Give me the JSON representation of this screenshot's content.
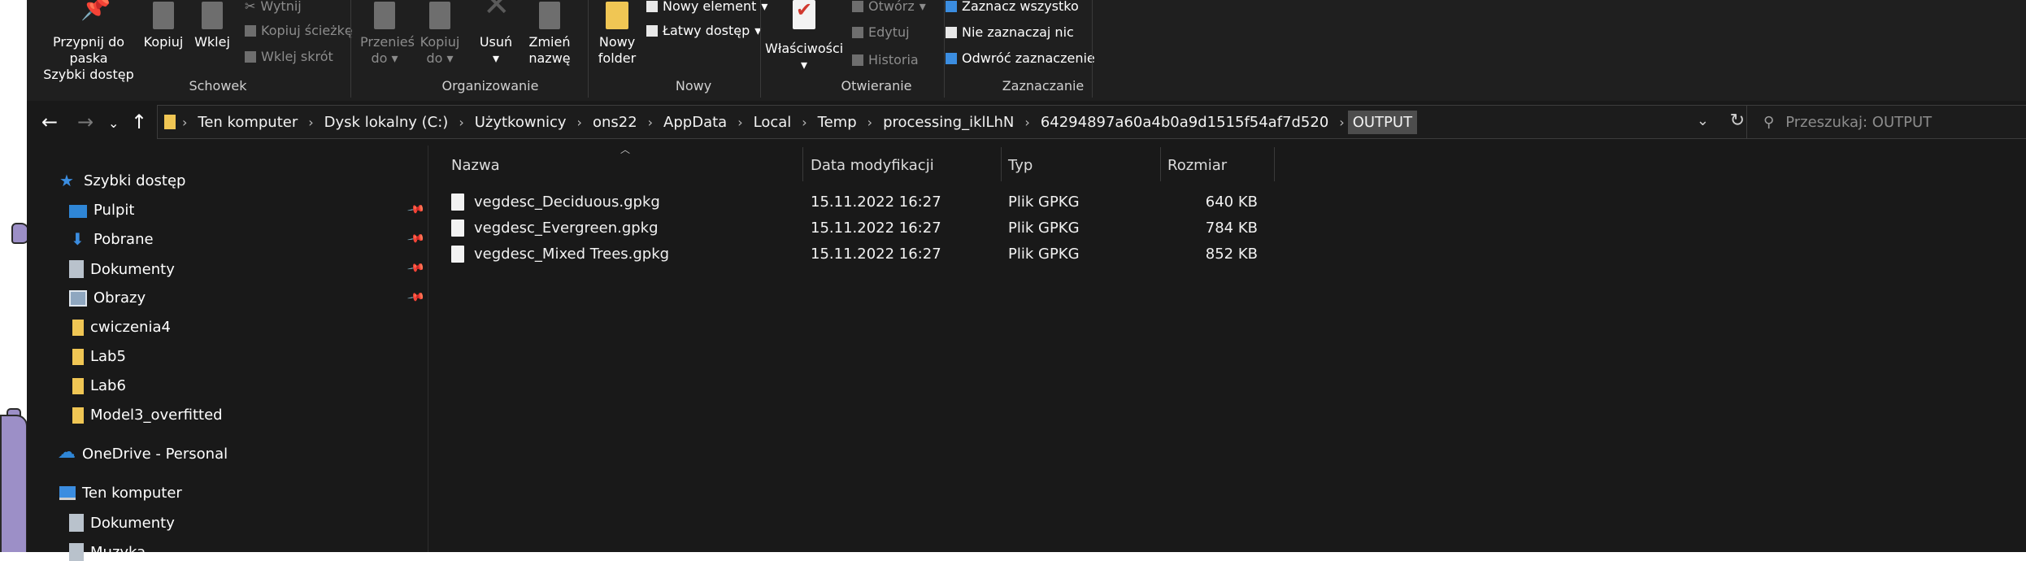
{
  "ribbon": {
    "schowek": {
      "label": "Schowek",
      "pin_label_1": "Przypnij do paska",
      "pin_label_2": "Szybki dostęp",
      "copy": "Kopiuj",
      "paste": "Wklej",
      "cut": "Wytnij",
      "copy_path": "Kopiuj ścieżkę",
      "paste_shortcut": "Wklej skrót"
    },
    "organizowanie": {
      "label": "Organizowanie",
      "move_1": "Przenieś",
      "move_2": "do",
      "copy_1": "Kopiuj",
      "copy_2": "do",
      "delete": "Usuń",
      "rename_1": "Zmień",
      "rename_2": "nazwę"
    },
    "nowy": {
      "label": "Nowy",
      "new_folder_1": "Nowy",
      "new_folder_2": "folder",
      "new_item": "Nowy element",
      "easy_access": "Łatwy dostęp"
    },
    "otwieranie": {
      "label": "Otwieranie",
      "properties": "Właściwości",
      "open": "Otwórz",
      "edit": "Edytuj",
      "history": "Historia"
    },
    "zaznaczanie": {
      "label": "Zaznaczanie",
      "select_all": "Zaznacz wszystko",
      "select_none": "Nie zaznaczaj nic",
      "invert": "Odwróć zaznaczenie"
    }
  },
  "address": {
    "crumbs": [
      "Ten komputer",
      "Dysk lokalny (C:)",
      "Użytkownicy",
      "ons22",
      "AppData",
      "Local",
      "Temp",
      "processing_iklLhN",
      "64294897a60a4b0a9d1515f54af7d520",
      "OUTPUT"
    ]
  },
  "search": {
    "placeholder": "Przeszukaj: OUTPUT"
  },
  "nav": {
    "quick_access": "Szybki dostęp",
    "items": [
      "Pulpit",
      "Pobrane",
      "Dokumenty",
      "Obrazy",
      "cwiczenia4",
      "Lab5",
      "Lab6",
      "Model3_overfitted"
    ],
    "onedrive": "OneDrive - Personal",
    "this_pc": "Ten komputer",
    "pc_items": [
      "Dokumenty",
      "Muzyka"
    ]
  },
  "list": {
    "headers": {
      "name": "Nazwa",
      "date": "Data modyfikacji",
      "type": "Typ",
      "size": "Rozmiar"
    },
    "files": [
      {
        "name": "vegdesc_Deciduous.gpkg",
        "date": "15.11.2022 16:27",
        "type": "Plik GPKG",
        "size": "640 KB"
      },
      {
        "name": "vegdesc_Evergreen.gpkg",
        "date": "15.11.2022 16:27",
        "type": "Plik GPKG",
        "size": "784 KB"
      },
      {
        "name": "vegdesc_Mixed Trees.gpkg",
        "date": "15.11.2022 16:27",
        "type": "Plik GPKG",
        "size": "852 KB"
      }
    ]
  }
}
